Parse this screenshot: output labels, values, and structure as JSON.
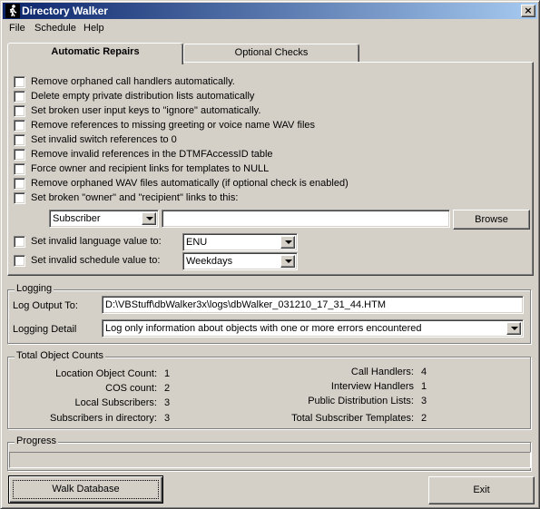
{
  "window": {
    "title": "Directory Walker",
    "close_glyph": "×",
    "icon": "walker-person-icon"
  },
  "menu": [
    "File",
    "Schedule",
    "Help"
  ],
  "tabs": [
    {
      "label": "Automatic Repairs",
      "active": true
    },
    {
      "label": "Optional Checks",
      "active": false
    }
  ],
  "repairs": {
    "options": [
      {
        "label": "Remove orphaned call handlers automatically.",
        "checked": false
      },
      {
        "label": "Delete empty private distribution lists automatically",
        "checked": false
      },
      {
        "label": "Set broken user input keys to \"ignore\" automatically.",
        "checked": false
      },
      {
        "label": "Remove references to missing greeting or voice name WAV files",
        "checked": false
      },
      {
        "label": "Set invalid switch references to 0",
        "checked": false
      },
      {
        "label": "Remove invalid references in the DTMFAccessID table",
        "checked": false
      },
      {
        "label": "Force owner and recipient links for templates to NULL",
        "checked": false
      },
      {
        "label": "Remove orphaned WAV files automatically (if optional check is enabled)",
        "checked": false
      },
      {
        "label": "Set broken \"owner\" and \"recipient\" links to this:",
        "checked": false
      }
    ],
    "owner_type": "Subscriber",
    "owner_value": "",
    "browse_label": "Browse",
    "language": {
      "label": "Set invalid language value to:",
      "checked": false,
      "value": "ENU"
    },
    "schedule": {
      "label": "Set invalid schedule value to:",
      "checked": false,
      "value": "Weekdays"
    }
  },
  "logging": {
    "group_label": "Logging",
    "output_label": "Log Output To:",
    "output_path": "D:\\VBStuff\\dbWalker3x\\logs\\dbWalker_031210_17_31_44.HTM",
    "detail_label": "Logging Detail",
    "detail_value": "Log only information about objects with one or more errors encountered"
  },
  "counts": {
    "group_label": "Total Object Counts",
    "left": [
      {
        "label": "Location Object Count:",
        "value": "1"
      },
      {
        "label": "COS count:",
        "value": "2"
      },
      {
        "label": "Local Subscribers:",
        "value": "3"
      },
      {
        "label": "Subscribers in directory:",
        "value": "3"
      }
    ],
    "right": [
      {
        "label": "Call Handlers:",
        "value": "4"
      },
      {
        "label": "Interview Handlers",
        "value": "1"
      },
      {
        "label": "Public Distribution Lists:",
        "value": "3"
      },
      {
        "label": "Total Subscriber Templates:",
        "value": "2"
      }
    ]
  },
  "progress": {
    "label": "Progress",
    "value": 0
  },
  "buttons": {
    "walk": "Walk Database",
    "exit": "Exit"
  }
}
